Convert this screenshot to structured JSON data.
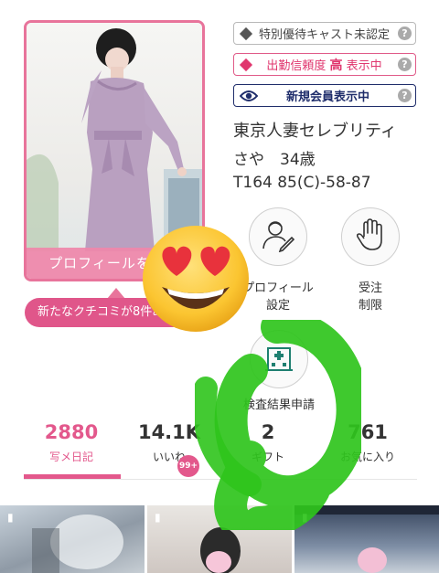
{
  "profile_card": {
    "button_label": "プロフィールを見る"
  },
  "review_notice": "新たなクチコミが8件あります",
  "badges": {
    "special": "特別優待キャスト未認定",
    "reliability_prefix": "出勤信頼度",
    "reliability_level": "高",
    "reliability_suffix": "表示中",
    "new_member": "新規会員表示中",
    "help": "?"
  },
  "cast": {
    "shop": "東京人妻セレブリティ",
    "name_age": "さや　34歳",
    "size": "T164 85(C)-58-87"
  },
  "actions": {
    "profile_settings_line1": "プロフィール",
    "profile_settings_line2": "設定",
    "refuse_line1": "受注",
    "refuse_line2": "制限",
    "medical": "検査結果申請"
  },
  "stats": [
    {
      "value": "2880",
      "label": "写メ日記"
    },
    {
      "value": "14.1K",
      "label": "いいね",
      "badge": "99+"
    },
    {
      "value": "2",
      "label": "ギフト"
    },
    {
      "value": "761",
      "label": "お気に入り"
    }
  ],
  "colors": {
    "accent": "#e3588c",
    "navy": "#1f2d6b",
    "overlay_green": "#2fc41c"
  },
  "icons": {
    "profile_settings": "person-edit-icon",
    "refuse": "hand-stop-icon",
    "medical": "hospital-icon",
    "thumb_pin": "pin-icon",
    "overlay": "heart-eyes-emoji"
  }
}
